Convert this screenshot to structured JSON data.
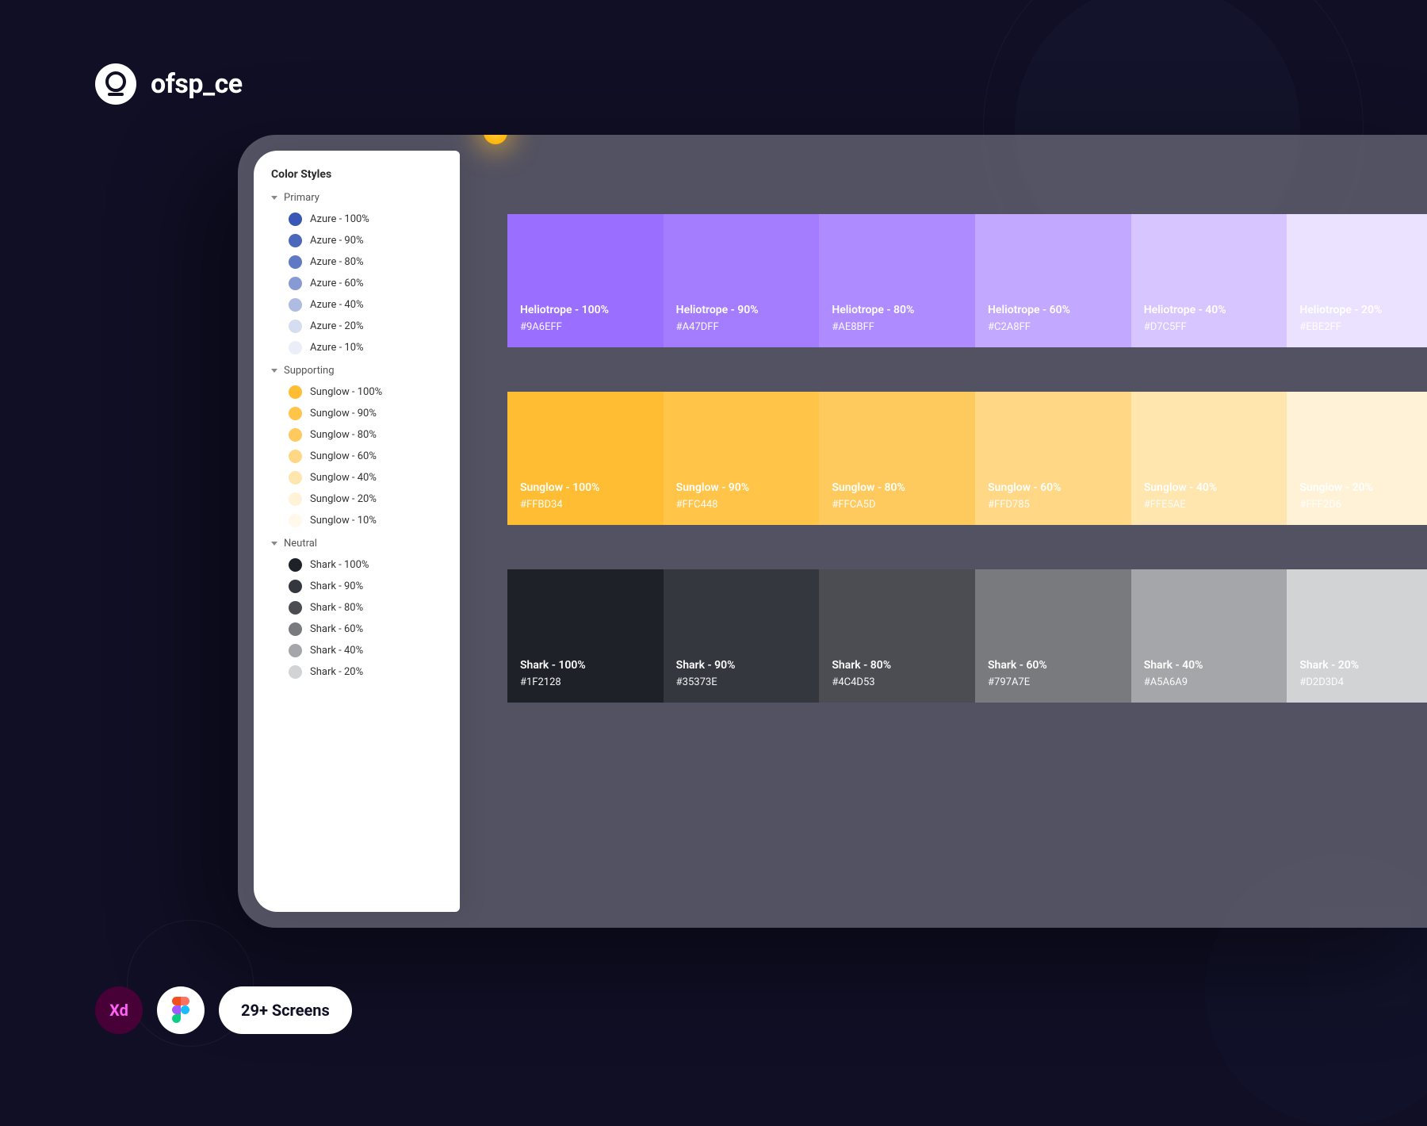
{
  "brand": {
    "name": "ofsp_ce"
  },
  "sidebar": {
    "title": "Color Styles",
    "groups": [
      {
        "name": "Primary",
        "items": [
          {
            "label": "Azure - 100%",
            "color": "#3857b6"
          },
          {
            "label": "Azure - 90%",
            "color": "#4c68bd"
          },
          {
            "label": "Azure - 80%",
            "color": "#6079c5"
          },
          {
            "label": "Azure - 60%",
            "color": "#889ad3"
          },
          {
            "label": "Azure - 40%",
            "color": "#afbce2"
          },
          {
            "label": "Azure - 20%",
            "color": "#d7ddf0"
          },
          {
            "label": "Azure - 10%",
            "color": "#ebeef8"
          }
        ]
      },
      {
        "name": "Supporting",
        "items": [
          {
            "label": "Sunglow - 100%",
            "color": "#FFBD34"
          },
          {
            "label": "Sunglow - 90%",
            "color": "#FFC448"
          },
          {
            "label": "Sunglow - 80%",
            "color": "#FFCA5D"
          },
          {
            "label": "Sunglow - 60%",
            "color": "#FFD785"
          },
          {
            "label": "Sunglow - 40%",
            "color": "#FFE5AE"
          },
          {
            "label": "Sunglow - 20%",
            "color": "#FFF2D6"
          },
          {
            "label": "Sunglow - 10%",
            "color": "#FFF8EB"
          }
        ]
      },
      {
        "name": "Neutral",
        "items": [
          {
            "label": "Shark - 100%",
            "color": "#1F2128"
          },
          {
            "label": "Shark - 90%",
            "color": "#35373E"
          },
          {
            "label": "Shark - 80%",
            "color": "#4C4D53"
          },
          {
            "label": "Shark - 60%",
            "color": "#797A7E"
          },
          {
            "label": "Shark - 40%",
            "color": "#A5A6A9"
          },
          {
            "label": "Shark - 20%",
            "color": "#D2D3D4"
          }
        ]
      }
    ]
  },
  "canvas": {
    "rows": [
      {
        "name": "heliotrope",
        "swatches": [
          {
            "label": "Heliotrope - 100%",
            "hex": "#9A6EFF"
          },
          {
            "label": "Heliotrope - 90%",
            "hex": "#A47DFF"
          },
          {
            "label": "Heliotrope - 80%",
            "hex": "#AE8BFF"
          },
          {
            "label": "Heliotrope - 60%",
            "hex": "#C2A8FF"
          },
          {
            "label": "Heliotrope - 40%",
            "hex": "#D7C5FF"
          },
          {
            "label": "Heliotrope - 20%",
            "hex": "#EBE2FF"
          }
        ]
      },
      {
        "name": "sunglow",
        "swatches": [
          {
            "label": "Sunglow - 100%",
            "hex": "#FFBD34"
          },
          {
            "label": "Sunglow - 90%",
            "hex": "#FFC448"
          },
          {
            "label": "Sunglow - 80%",
            "hex": "#FFCA5D"
          },
          {
            "label": "Sunglow - 60%",
            "hex": "#FFD785"
          },
          {
            "label": "Sunglow - 40%",
            "hex": "#FFE5AE"
          },
          {
            "label": "Sunglow - 20%",
            "hex": "#FFF2D6"
          }
        ]
      },
      {
        "name": "shark",
        "swatches": [
          {
            "label": "Shark - 100%",
            "hex": "#1F2128"
          },
          {
            "label": "Shark - 90%",
            "hex": "#35373E"
          },
          {
            "label": "Shark - 80%",
            "hex": "#4C4D53"
          },
          {
            "label": "Shark - 60%",
            "hex": "#797A7E"
          },
          {
            "label": "Shark - 40%",
            "hex": "#A5A6A9"
          },
          {
            "label": "Shark - 20%",
            "hex": "#D2D3D4"
          }
        ]
      }
    ]
  },
  "badges": {
    "xd": "Xd",
    "screens": "29+ Screens"
  }
}
